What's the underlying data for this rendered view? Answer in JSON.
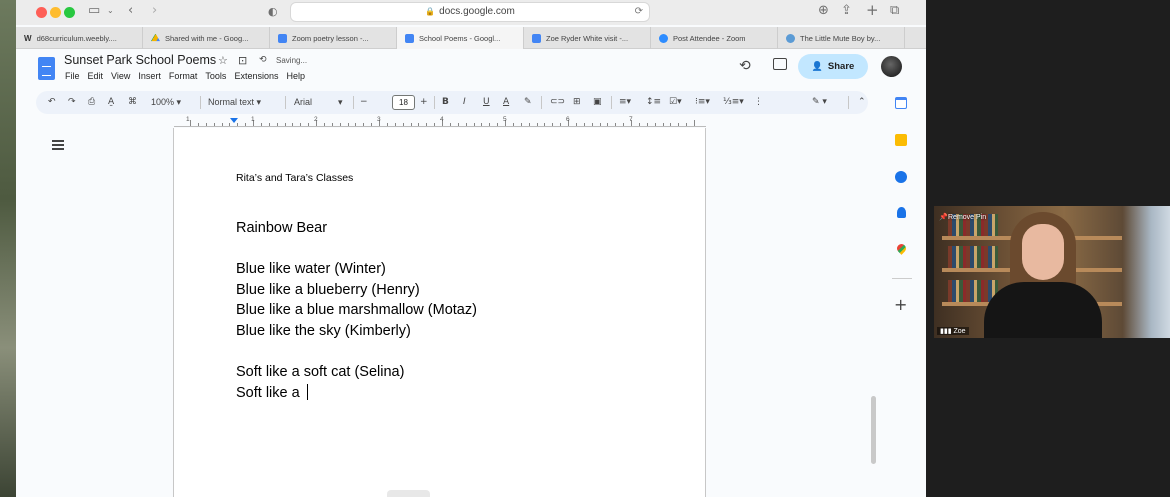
{
  "browser": {
    "url": "docs.google.com",
    "tabs": [
      {
        "label": "d68curriculum.weebly....",
        "icon": "weebly-icon"
      },
      {
        "label": "Shared with me - Goog...",
        "icon": "drive-icon"
      },
      {
        "label": "Zoom poetry lesson -...",
        "icon": "docs-icon"
      },
      {
        "label": "School Poems - Googl...",
        "icon": "docs-icon",
        "active": true
      },
      {
        "label": "Zoe Ryder White visit -...",
        "icon": "docs-icon"
      },
      {
        "label": "Post Attendee - Zoom",
        "icon": "zoom-icon"
      },
      {
        "label": "The Little Mute Boy by...",
        "icon": "globe-icon"
      }
    ]
  },
  "docs": {
    "title": "Sunset Park School Poems",
    "status": "Saving...",
    "menu": [
      "File",
      "Edit",
      "View",
      "Insert",
      "Format",
      "Tools",
      "Extensions",
      "Help"
    ],
    "share_label": "Share",
    "toolbar": {
      "zoom": "100%",
      "style": "Normal text",
      "font": "Arial",
      "font_size": "18"
    }
  },
  "ruler": {
    "numbers": [
      "1",
      "1",
      "2",
      "3",
      "4",
      "5",
      "6",
      "7"
    ]
  },
  "document": {
    "header": "Rita’s and Tara’s Classes",
    "lines": [
      "Rainbow Bear",
      "",
      "Blue like water (Winter)",
      "Blue like a blueberry (Henry)",
      "Blue like a blue marshmallow (Motaz)",
      "Blue like the sky (Kimberly)",
      "",
      "Soft like a soft cat (Selina)",
      "Soft like a "
    ]
  },
  "zoom": {
    "remove_pin": "Remove Pin",
    "participant": "Zoe"
  },
  "colors": {
    "share_bg": "#c2e7ff",
    "toolbar_bg": "#edf2fa",
    "docs_blue": "#4285f4"
  }
}
